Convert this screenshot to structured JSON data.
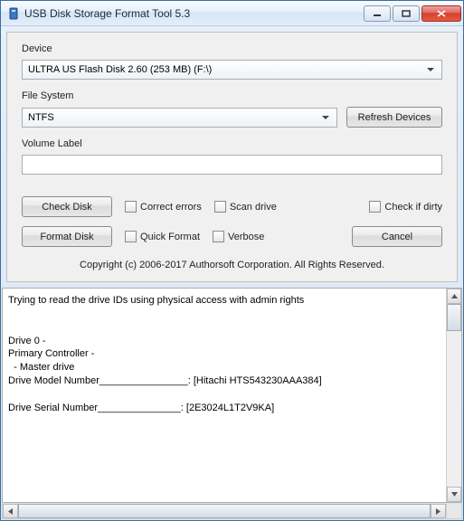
{
  "window": {
    "title": "USB Disk Storage Format Tool 5.3"
  },
  "labels": {
    "device": "Device",
    "filesystem": "File System",
    "volume_label": "Volume Label"
  },
  "device": {
    "selected": "ULTRA US  Flash Disk  2.60 (253 MB) (F:\\)"
  },
  "filesystem": {
    "selected": "NTFS"
  },
  "volume": {
    "value": ""
  },
  "buttons": {
    "refresh": "Refresh Devices",
    "check_disk": "Check Disk",
    "format_disk": "Format Disk",
    "cancel": "Cancel"
  },
  "checkboxes": {
    "correct_errors": "Correct errors",
    "scan_drive": "Scan drive",
    "check_if_dirty": "Check if dirty",
    "quick_format": "Quick Format",
    "verbose": "Verbose"
  },
  "copyright": "Copyright (c) 2006-2017 Authorsoft Corporation. All Rights Reserved.",
  "log": "Trying to read the drive IDs using physical access with admin rights\n\n\nDrive 0 -\nPrimary Controller -\n  - Master drive\nDrive Model Number________________: [Hitachi HTS543230AAA384]\n\nDrive Serial Number_______________: [2E3024L1T2V9KA]"
}
